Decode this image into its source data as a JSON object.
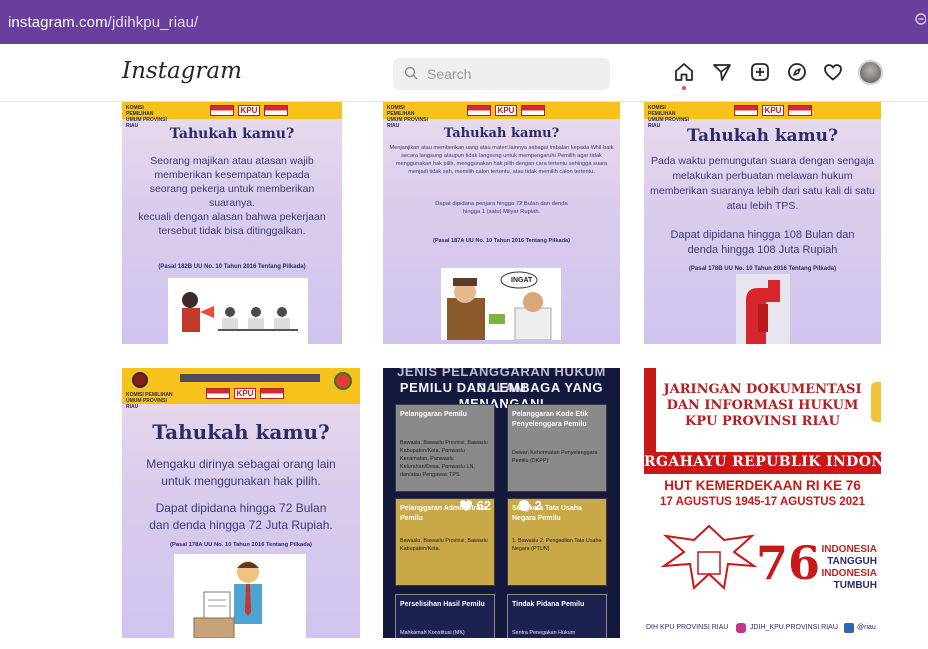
{
  "browser": {
    "url_host": "instagram.com",
    "url_path": "/jdihkpu_riau/",
    "zoom_icon": "zoom-icon"
  },
  "header": {
    "logo": "Instagram",
    "search_placeholder": "Search",
    "nav_icons": [
      "home-icon",
      "direct-message-icon",
      "new-post-icon",
      "explore-icon",
      "activity-heart-icon",
      "profile-avatar"
    ]
  },
  "posts": {
    "p1": {
      "org": "KOMISI PEMILIHAN UMUM PROVINSI RIAU",
      "kpu": "KPU",
      "title": "Tahukah kamu?",
      "body": "Seorang majikan atau atasan wajib memberikan kesempatan kepada seorang pekerja untuk memberikan suaranya.",
      "body2": "kecuali dengan alasan bahwa pekerjaan tersebut tidak bisa ditinggalkan.",
      "ref": "(Pasal 182B UU No. 10 Tahun 2016 Tentang Pilkada)"
    },
    "p2": {
      "org": "KOMISI PEMILIHAN UMUM PROVINSI RIAU",
      "kpu": "KPU",
      "title": "Tahukah kamu?",
      "body": "Menjanjikan atau memberikan uang atau materi lainnya sebagai imbalan kepada WNI baik secara langsung ataupun tidak langsung untuk mempengaruhi Pemilih agar tidak menggunakan hak pilih, menggunakan hak pilih dengan cara tertentu sehingga suara menjadi tidak sah, memilih calon tertentu, atau tidak memilih calon tertentu.",
      "body2": "Dapat dipidana penjara hingga 72 Bulan dan denda hingga 1 (satu) Milyar Rupiah.",
      "ref": "(Pasal 187A UU No. 10 Tahun 2016 Tentang Pilkada)",
      "bubble": "INGAT"
    },
    "p3": {
      "org": "KOMISI PEMILIHAN UMUM PROVINSI RIAU",
      "kpu": "KPU",
      "title": "Tahukah kamu?",
      "body": "Pada waktu pemungutan suara dengan sengaja melakukan perbuatan melawan hukum memberikan suaranya lebih dari satu kali di satu atau lebih TPS.",
      "body2": "Dapat dipidana hingga 108 Bulan dan denda hingga 108 Juta Rupiah",
      "ref": "(Pasal 178B UU No. 10 Tahun 2016 Tentang Pilkada)"
    },
    "p4": {
      "org": "KOMISI PEMILIHAN UMUM PROVINSI RIAU",
      "kpu": "KPU",
      "title": "Tahukah kamu?",
      "body": "Mengaku dirinya sebagai orang lain untuk menggunakan hak pilih.",
      "body2": "Dapat dipidana hingga 72 Bulan dan denda hingga 72 Juta Rupiah.",
      "ref": "(Pasal 178A UU No. 10 Tahun 2016 Tentang Pilkada)"
    },
    "p5": {
      "heading_top": "JENIS PELANGGARAN HUKUM DALAM",
      "heading_mid": "PEMILU DAN LEMBAGA YANG",
      "heading_bot": "MENANGANI",
      "cells": [
        {
          "h": "Pelanggaran Pemilu",
          "b": "Bawaslu, Bawaslu Provinsi, Bawaslu Kabupaten/Kota, Panwaslu Kecamatan, Panwaslu Kelurahan/Desa, Panwaslu LN, dan/atau Pengawas TPS."
        },
        {
          "h": "Pelanggaran Kode Etik Penyelenggara Pemilu",
          "b": "Dewan Kehormatan Penyelenggara Pemilu (DKPP)"
        },
        {
          "h": "Pelanggaran Administrasi Pemilu",
          "b": "Bawaslu, Bawaslu Provinsi, Bawaslu Kabupaten/Kota."
        },
        {
          "h": "Sengketa Tata Usaha Negara Pemilu",
          "b": "1. Bawaslu 2. Pengadilan Tata Usaha Negara (PTUN)"
        },
        {
          "h": "Perselisihan Hasil Pemilu",
          "b": "Mahkamah Konstitusi (MK)"
        },
        {
          "h": "Tindak Pidana Pemilu",
          "b": "Sentra Penegakan Hukum"
        }
      ],
      "likes": "62",
      "comments": "2"
    },
    "p6": {
      "line1": "JARINGAN DOKUMENTASI",
      "line2": "DAN INFORMASI HUKUM",
      "line3": "KPU PROVINSI RIAU",
      "banner": "RGAHAYU REPUBLIK INDONE",
      "hut": "HUT KEMERDEKAAN RI KE 76",
      "dates": "17 AGUSTUS 1945-17 AGUSTUS 2021",
      "number": "76",
      "slogan1": "INDONESIA",
      "slogan2": "TANGGUH",
      "slogan3": "INDONESIA",
      "slogan4": "TUMBUH",
      "footer_left": "DIH KPU PROVINSI RIAU",
      "footer_mid": "JDIH_KPU.PROVINSI RIAU",
      "footer_right": "@riau"
    }
  },
  "colors": {
    "browser_bar": "#6a3e9c",
    "band_gold": "#f6c21b",
    "title_navy": "#2d2b66",
    "dark_post": "#14183c",
    "cell_grey": "#8a8a8a",
    "cell_gold": "#c9a848",
    "hut_red": "#c81818"
  }
}
